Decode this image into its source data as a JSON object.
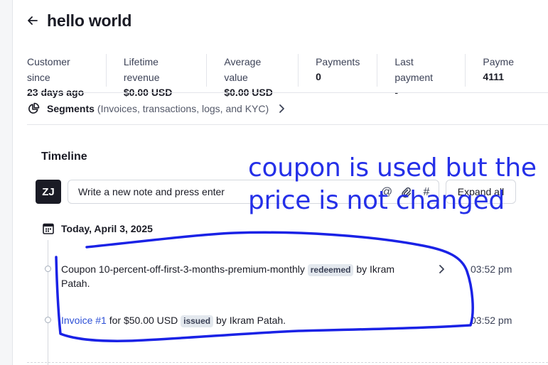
{
  "header": {
    "title": "hello world"
  },
  "stats": [
    {
      "label": "Customer since",
      "value": "23 days ago"
    },
    {
      "label": "Lifetime revenue",
      "value": "$0.00 USD"
    },
    {
      "label": "Average value",
      "value": "$0.00 USD"
    },
    {
      "label": "Payments",
      "value": "0"
    },
    {
      "label": "Last payment",
      "value": "-"
    },
    {
      "label": "Payme",
      "value": "4111"
    }
  ],
  "segments": {
    "title": "Segments",
    "subtitle": "(Invoices, transactions, logs, and KYC)"
  },
  "timeline": {
    "title": "Timeline",
    "avatar_initials": "ZJ",
    "note_placeholder": "Write a new note and press enter",
    "expand_label": "Expand all",
    "date_label": "Today, April 3, 2025",
    "events": [
      {
        "prefix": "Coupon 10-percent-off-first-3-months-premium-monthly",
        "badge": "redeemed",
        "suffix": "by Ikram",
        "suffix2": "Patah.",
        "time": "03:52 pm"
      },
      {
        "link": "Invoice #1",
        "middle": "for $50.00 USD",
        "badge": "issued",
        "suffix": "by Ikram Patah.",
        "time": "03:52 pm"
      }
    ]
  },
  "annotation": {
    "line1": "coupon is used but the",
    "line2": "price is not changed",
    "color": "#2530e8"
  }
}
